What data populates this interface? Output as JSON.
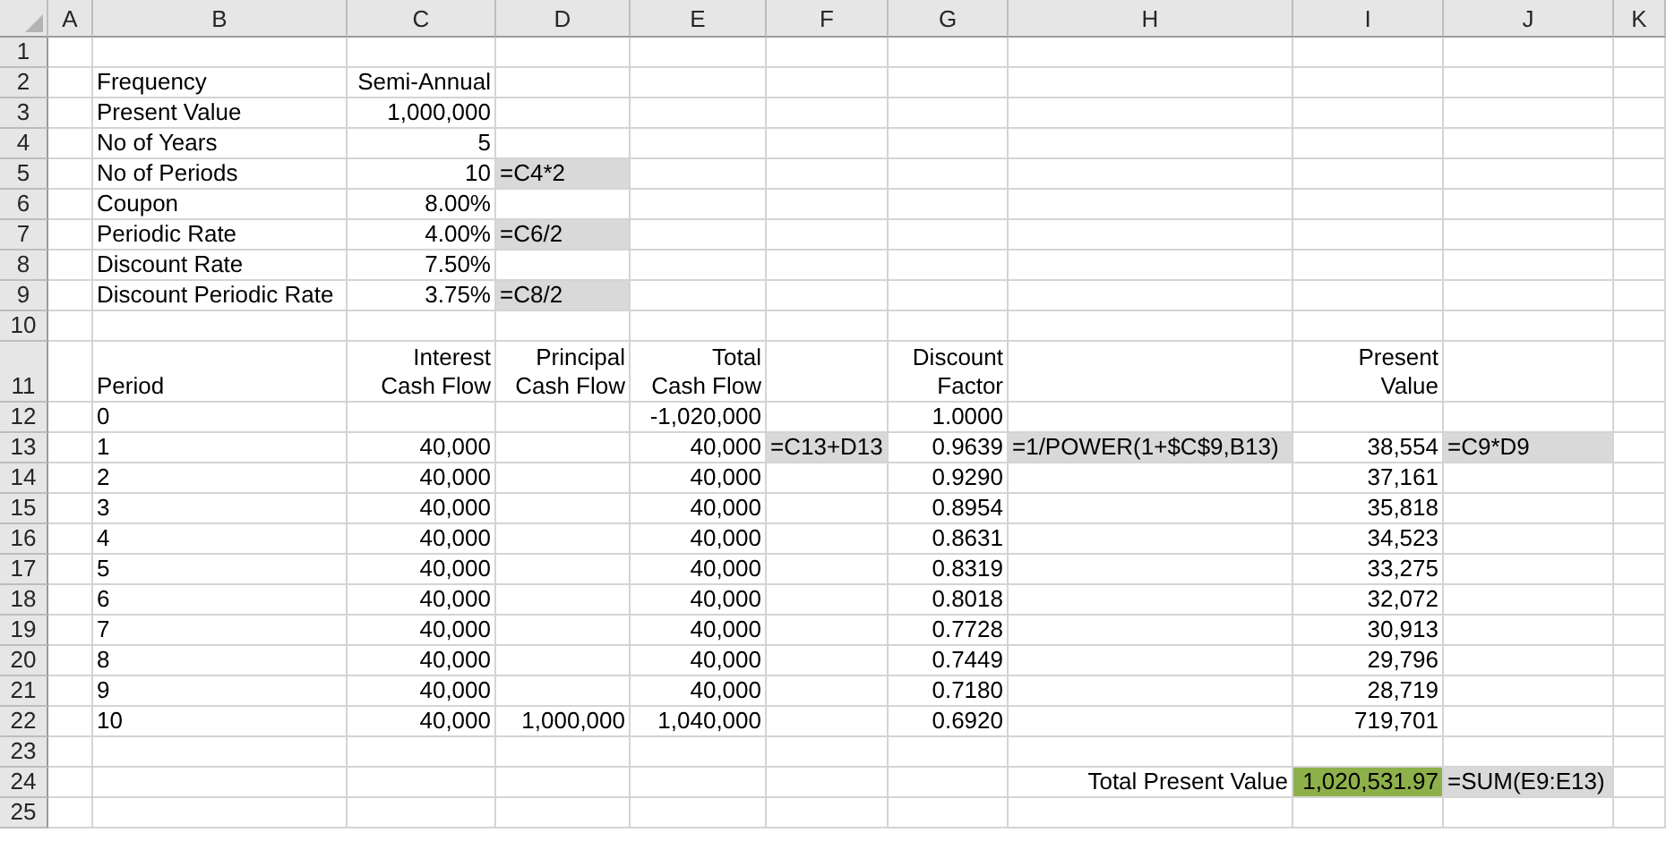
{
  "columns": [
    "A",
    "B",
    "C",
    "D",
    "E",
    "F",
    "G",
    "H",
    "I",
    "J",
    "K"
  ],
  "rows": [
    {
      "number": "1"
    },
    {
      "number": "2",
      "cells": {
        "B": {
          "text": "Frequency"
        },
        "C": {
          "text": "Semi-Annual"
        }
      }
    },
    {
      "number": "3",
      "cells": {
        "B": {
          "text": "Present Value"
        },
        "C": {
          "text": "1,000,000"
        }
      }
    },
    {
      "number": "4",
      "cells": {
        "B": {
          "text": "No of Years"
        },
        "C": {
          "text": "5"
        }
      }
    },
    {
      "number": "5",
      "cells": {
        "B": {
          "text": "No of Periods"
        },
        "C": {
          "text": "10"
        },
        "D": {
          "text": "=C4*2",
          "kind": "formula"
        }
      }
    },
    {
      "number": "6",
      "cells": {
        "B": {
          "text": "Coupon"
        },
        "C": {
          "text": "8.00%"
        }
      }
    },
    {
      "number": "7",
      "cells": {
        "B": {
          "text": "Periodic Rate"
        },
        "C": {
          "text": "4.00%"
        },
        "D": {
          "text": "=C6/2",
          "kind": "formula"
        }
      }
    },
    {
      "number": "8",
      "cells": {
        "B": {
          "text": "Discount Rate"
        },
        "C": {
          "text": "7.50%"
        }
      }
    },
    {
      "number": "9",
      "cells": {
        "B": {
          "text": "Discount Periodic Rate"
        },
        "C": {
          "text": "3.75%"
        },
        "D": {
          "text": "=C8/2",
          "kind": "formula"
        }
      }
    },
    {
      "number": "10"
    },
    {
      "number": "11",
      "cells": {
        "B": {
          "text": "Period"
        },
        "C": {
          "text": "Interest\nCash Flow"
        },
        "D": {
          "text": "Principal\nCash Flow"
        },
        "E": {
          "text": "Total\nCash Flow"
        },
        "G": {
          "text": "Discount\nFactor"
        },
        "I": {
          "text": "Present\nValue"
        }
      }
    },
    {
      "number": "12",
      "cells": {
        "B": {
          "text": "0"
        },
        "E": {
          "text": "-1,020,000"
        },
        "G": {
          "text": "1.0000"
        }
      }
    },
    {
      "number": "13",
      "cells": {
        "B": {
          "text": "1"
        },
        "C": {
          "text": "40,000"
        },
        "E": {
          "text": "40,000"
        },
        "F": {
          "text": "=C13+D13",
          "kind": "formula"
        },
        "G": {
          "text": "0.9639"
        },
        "H": {
          "text": "=1/POWER(1+$C$9,B13)",
          "kind": "formula"
        },
        "I": {
          "text": "38,554"
        },
        "J": {
          "text": "=C9*D9",
          "kind": "formula"
        }
      }
    },
    {
      "number": "14",
      "cells": {
        "B": {
          "text": "2"
        },
        "C": {
          "text": "40,000"
        },
        "E": {
          "text": "40,000"
        },
        "G": {
          "text": "0.9290"
        },
        "I": {
          "text": "37,161"
        }
      }
    },
    {
      "number": "15",
      "cells": {
        "B": {
          "text": "3"
        },
        "C": {
          "text": "40,000"
        },
        "E": {
          "text": "40,000"
        },
        "G": {
          "text": "0.8954"
        },
        "I": {
          "text": "35,818"
        }
      }
    },
    {
      "number": "16",
      "cells": {
        "B": {
          "text": "4"
        },
        "C": {
          "text": "40,000"
        },
        "E": {
          "text": "40,000"
        },
        "G": {
          "text": "0.8631"
        },
        "I": {
          "text": "34,523"
        }
      }
    },
    {
      "number": "17",
      "cells": {
        "B": {
          "text": "5"
        },
        "C": {
          "text": "40,000"
        },
        "E": {
          "text": "40,000"
        },
        "G": {
          "text": "0.8319"
        },
        "I": {
          "text": "33,275"
        }
      }
    },
    {
      "number": "18",
      "cells": {
        "B": {
          "text": "6"
        },
        "C": {
          "text": "40,000"
        },
        "E": {
          "text": "40,000"
        },
        "G": {
          "text": "0.8018"
        },
        "I": {
          "text": "32,072"
        }
      }
    },
    {
      "number": "19",
      "cells": {
        "B": {
          "text": "7"
        },
        "C": {
          "text": "40,000"
        },
        "E": {
          "text": "40,000"
        },
        "G": {
          "text": "0.7728"
        },
        "I": {
          "text": "30,913"
        }
      }
    },
    {
      "number": "20",
      "cells": {
        "B": {
          "text": "8"
        },
        "C": {
          "text": "40,000"
        },
        "E": {
          "text": "40,000"
        },
        "G": {
          "text": "0.7449"
        },
        "I": {
          "text": "29,796"
        }
      }
    },
    {
      "number": "21",
      "cells": {
        "B": {
          "text": "9"
        },
        "C": {
          "text": "40,000"
        },
        "E": {
          "text": "40,000"
        },
        "G": {
          "text": "0.7180"
        },
        "I": {
          "text": "28,719"
        }
      }
    },
    {
      "number": "22",
      "cells": {
        "B": {
          "text": "10"
        },
        "C": {
          "text": "40,000"
        },
        "D": {
          "text": "1,000,000"
        },
        "E": {
          "text": "1,040,000"
        },
        "G": {
          "text": "0.6920"
        },
        "I": {
          "text": "719,701"
        }
      }
    },
    {
      "number": "23"
    },
    {
      "number": "24",
      "cells": {
        "H": {
          "text": "Total Present Value"
        },
        "I": {
          "text": "1,020,531.97",
          "kind": "highlight"
        },
        "J": {
          "text": "=SUM(E9:E13)",
          "kind": "formula"
        }
      }
    },
    {
      "number": "25"
    }
  ]
}
